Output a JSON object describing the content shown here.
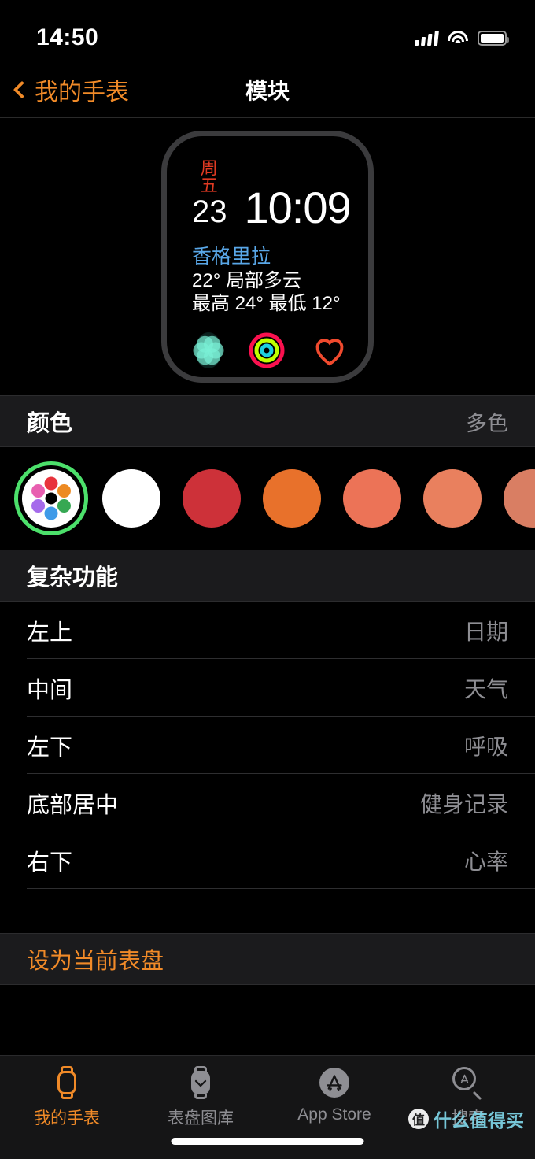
{
  "status_bar": {
    "time": "14:50",
    "signal_icon": "cellular-signal-icon",
    "wifi_icon": "wifi-icon",
    "battery_icon": "battery-icon"
  },
  "nav": {
    "back_label": "我的手表",
    "back_icon": "chevron-left-icon",
    "title": "模块",
    "accent_color": "#F08A28"
  },
  "watch_face": {
    "day_of_week": "周五",
    "day_of_week_color": "#E03A22",
    "day": "23",
    "time": "10:09",
    "city": "香格里拉",
    "city_color": "#59A7E8",
    "condition": "22° 局部多云",
    "high_low": "最高 24° 最低 12°",
    "complications": [
      {
        "name": "breathe-complication",
        "label": "呼吸"
      },
      {
        "name": "activity-rings-complication",
        "label": "健身记录"
      },
      {
        "name": "heart-rate-complication",
        "label": "心率"
      }
    ]
  },
  "color_section": {
    "title": "颜色",
    "value": "多色",
    "selected_index": 0,
    "selection_ring_color": "#4CE06B",
    "swatches": [
      {
        "name": "multicolor",
        "color": "#ffffff",
        "multicolor": true
      },
      {
        "name": "white",
        "color": "#ffffff"
      },
      {
        "name": "crimson",
        "color": "#CD3139"
      },
      {
        "name": "orange",
        "color": "#E8712B"
      },
      {
        "name": "salmon",
        "color": "#EC7357"
      },
      {
        "name": "coral",
        "color": "#E9805E"
      },
      {
        "name": "dusty-coral",
        "color": "#D97E63"
      }
    ],
    "multicolor_dots": [
      "#E8333C",
      "#ED8A22",
      "#36A853",
      "#3F9BE8",
      "#A56BEB",
      "#E85FB0"
    ]
  },
  "complication_section": {
    "title": "复杂功能",
    "rows": [
      {
        "label": "左上",
        "value": "日期"
      },
      {
        "label": "中间",
        "value": "天气"
      },
      {
        "label": "左下",
        "value": "呼吸"
      },
      {
        "label": "底部居中",
        "value": "健身记录"
      },
      {
        "label": "右下",
        "value": "心率"
      }
    ]
  },
  "action": {
    "label": "设为当前表盘"
  },
  "tab_bar": {
    "tabs": [
      {
        "label": "我的手表",
        "icon": "watch-icon",
        "active": true
      },
      {
        "label": "表盘图库",
        "icon": "watch-face-gallery-icon",
        "active": false
      },
      {
        "label": "App Store",
        "icon": "app-store-icon",
        "active": false
      },
      {
        "label": "搜索",
        "icon": "search-icon",
        "active": false
      }
    ]
  },
  "watermark": {
    "badge": "值",
    "text": "什么值得买"
  }
}
